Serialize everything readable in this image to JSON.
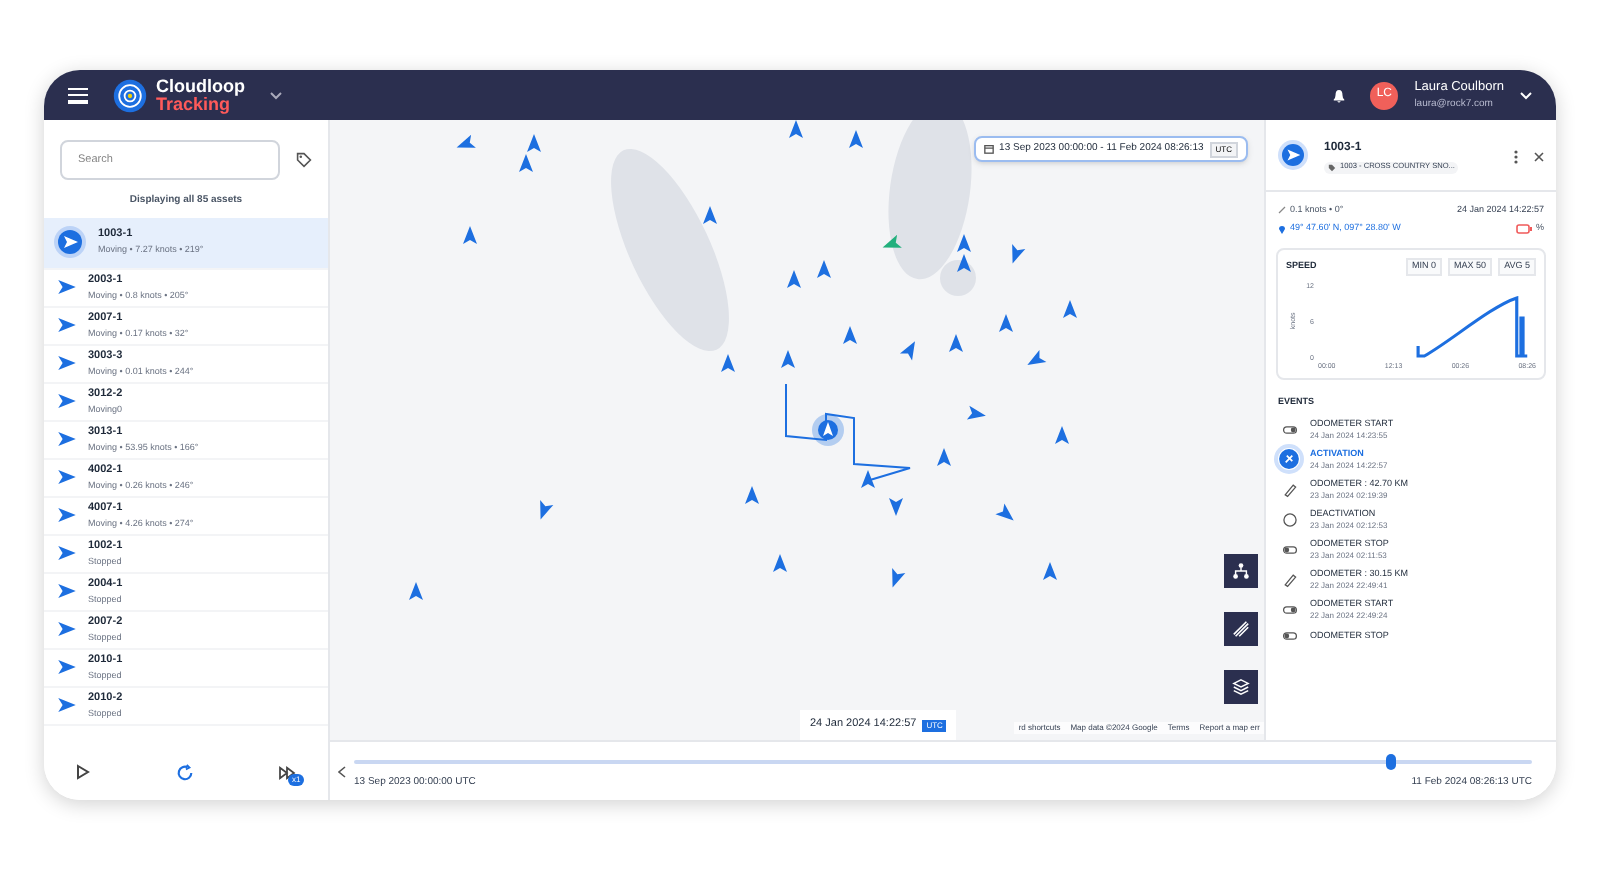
{
  "header": {
    "brand_top": "Cloudloop",
    "brand_bottom": "Tracking",
    "user": {
      "initials": "LC",
      "name": "Laura Coulborn",
      "email": "laura@rock7.com"
    }
  },
  "sidebar": {
    "search": {
      "placeholder": "Search"
    },
    "summary": "Displaying all 85 assets",
    "assets": [
      {
        "name": "1003-1",
        "status": "Moving • 7.27 knots • 219°",
        "selected": true
      },
      {
        "name": "2003-1",
        "status": "Moving • 0.8 knots • 205°",
        "selected": false
      },
      {
        "name": "2007-1",
        "status": "Moving • 0.17 knots • 32°",
        "selected": false
      },
      {
        "name": "3003-3",
        "status": "Moving • 0.01 knots • 244°",
        "selected": false
      },
      {
        "name": "3012-2",
        "status": "Moving0",
        "selected": false
      },
      {
        "name": "3013-1",
        "status": "Moving • 53.95 knots • 166°",
        "selected": false
      },
      {
        "name": "4002-1",
        "status": "Moving • 0.26 knots • 246°",
        "selected": false
      },
      {
        "name": "4007-1",
        "status": "Moving • 4.26 knots • 274°",
        "selected": false
      },
      {
        "name": "1002-1",
        "status": "Stopped",
        "selected": false
      },
      {
        "name": "2004-1",
        "status": "Stopped",
        "selected": false
      },
      {
        "name": "2007-2",
        "status": "Stopped",
        "selected": false
      },
      {
        "name": "2010-1",
        "status": "Stopped",
        "selected": false
      },
      {
        "name": "2010-2",
        "status": "Stopped",
        "selected": false
      }
    ],
    "speed_badge": "x1"
  },
  "map": {
    "date_range": "13 Sep 2023 00:00:00 - 11 Feb 2024 08:26:13",
    "date_range_zone": "UTC",
    "tooltip_time": "24 Jan 2024 14:22:57",
    "tooltip_zone": "UTC",
    "attribution": [
      "rd shortcuts",
      "Map data ©2024 Google",
      "Terms",
      "Report a map err"
    ]
  },
  "detail": {
    "name": "1003-1",
    "tag": "1003 - CROSS COUNTRY SNO...",
    "motion": "0.1 knots • 0°",
    "time": "24 Jan 2024 14:22:57",
    "position": "49° 47.60' N, 097° 28.80' W",
    "battery": "%",
    "speed": {
      "title": "SPEED",
      "min_label": "MIN",
      "min": "0",
      "max_label": "MAX",
      "max": "50",
      "avg_label": "AVG",
      "avg": "5",
      "ylabel": "knots",
      "y_labels": [
        "12",
        "6",
        "0"
      ],
      "x_labels": [
        "00:00",
        "12:13",
        "00:26",
        "08:26"
      ]
    },
    "events_title": "EVENTS",
    "events": [
      {
        "kind": "odometer_start",
        "title": "ODOMETER START",
        "time": "24 Jan 2024 14:23:55",
        "selected": false
      },
      {
        "kind": "activation",
        "title": "ACTIVATION",
        "time": "24 Jan 2024 14:22:57",
        "selected": true
      },
      {
        "kind": "odometer",
        "title": "ODOMETER : 42.70 KM",
        "time": "23 Jan 2024 02:19:39",
        "selected": false
      },
      {
        "kind": "deactivation",
        "title": "DEACTIVATION",
        "time": "23 Jan 2024 02:12:53",
        "selected": false
      },
      {
        "kind": "odometer_stop",
        "title": "ODOMETER STOP",
        "time": "23 Jan 2024 02:11:53",
        "selected": false
      },
      {
        "kind": "odometer",
        "title": "ODOMETER : 30.15 KM",
        "time": "22 Jan 2024 22:49:41",
        "selected": false
      },
      {
        "kind": "odometer_start",
        "title": "ODOMETER START",
        "time": "22 Jan 2024 22:49:24",
        "selected": false
      },
      {
        "kind": "odometer_stop",
        "title": "ODOMETER STOP",
        "selected": false
      }
    ]
  },
  "timeline": {
    "start": "13 Sep 2023 00:00:00 UTC",
    "end": "11 Feb 2024 08:26:13 UTC",
    "level": 0.88
  }
}
